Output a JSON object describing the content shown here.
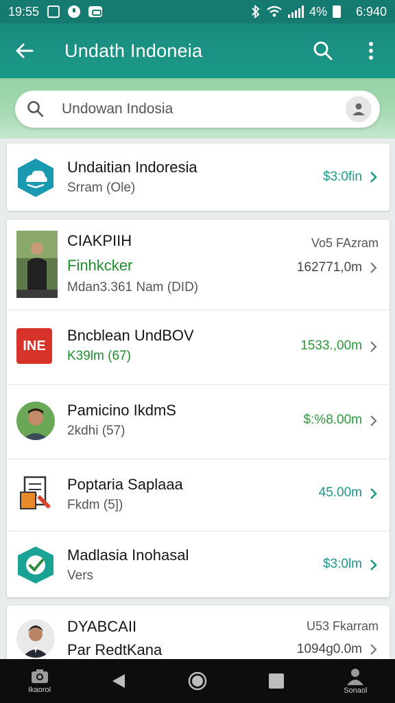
{
  "status_bar": {
    "time_left": "19:55",
    "battery": "4%",
    "time_right": "6:940"
  },
  "app_bar": {
    "title": "Undath Indoneia"
  },
  "search": {
    "placeholder": "Undowan Indosia"
  },
  "colors": {
    "app_bar": "#1a8a7e",
    "accent_teal": "#1a9a86",
    "accent_green": "#2a9a3a",
    "search_band": "#a8dbb3",
    "bottom_nav": "#0d0d0d"
  },
  "top_item": {
    "title": "Undaitian Indoresia",
    "subtitle": "Srram (Ole)",
    "amount": "$3:0fin",
    "icon": "cloud-book-icon"
  },
  "items": [
    {
      "title": "CIAKPIIH",
      "subtitle": "Finhkcker",
      "detail": "Mdan3.361 Nam (DID)",
      "extra": "Vo5 FAzram",
      "amount": "162771,0m",
      "thumb": "person-photo"
    },
    {
      "title": "Bncblean UndBOV",
      "subtitle": "K39lm (67)",
      "amount": "1533.,00m",
      "thumb": "logo-ine",
      "logo_text": "INE"
    },
    {
      "title": "Pamicino IkdmS",
      "subtitle": "2kdhi (57)",
      "amount": "$:%8.00m",
      "thumb": "person-avatar"
    },
    {
      "title": "Poptaria Saplaaa",
      "subtitle": "Fkdm (5])",
      "amount": "45.00m",
      "thumb": "document-pen-icon"
    },
    {
      "title": "Madlasia Inohasal",
      "subtitle": "Vers",
      "amount": "$3:0lm",
      "thumb": "check-hex-icon"
    },
    {
      "title": "DYABCAII",
      "subtitle": "Par RedtKana",
      "extra": "U53 Fkarram",
      "amount": "1094g0.0m",
      "thumb": "person-suit"
    }
  ],
  "bottom_nav": [
    {
      "label": "Ikaorol",
      "icon": "camera-icon"
    },
    {
      "label": "",
      "icon": "back-triangle-icon"
    },
    {
      "label": "",
      "icon": "home-circle-icon"
    },
    {
      "label": "",
      "icon": "recents-square-icon"
    },
    {
      "label": "Sonaol",
      "icon": "profile-icon"
    }
  ]
}
